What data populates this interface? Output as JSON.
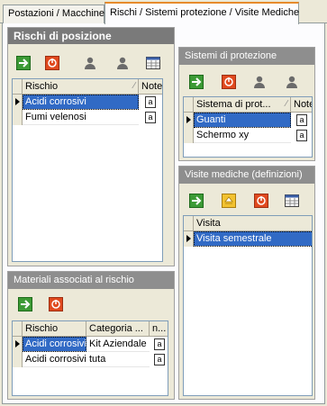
{
  "tabs": [
    {
      "label": "Postazioni / Macchine"
    },
    {
      "label": "Rischi / Sistemi protezione / Visite Mediche"
    }
  ],
  "rischi": {
    "title": "Rischi di posizione",
    "columns": [
      "Rischio",
      "Note"
    ],
    "rows": [
      {
        "rischio": "Acidi corrosivi",
        "selected": true
      },
      {
        "rischio": "Fumi velenosi",
        "selected": false
      }
    ]
  },
  "materiali": {
    "title": "Materiali associati al rischio",
    "columns": [
      "Rischio",
      "Categoria ...",
      "n..."
    ],
    "rows": [
      {
        "rischio": "Acidi corrosivi",
        "categoria": "Kit Aziendale",
        "selected": true
      },
      {
        "rischio": "Acidi corrosivi",
        "categoria": "tuta",
        "selected": false
      }
    ]
  },
  "sistemi": {
    "title": "Sistemi di protezione",
    "columns": [
      "Sistema di prot...",
      "Note"
    ],
    "rows": [
      {
        "sistema": "Guanti",
        "selected": true
      },
      {
        "sistema": "Schermo xy",
        "selected": false
      }
    ]
  },
  "visite": {
    "title": "Visite mediche (definizioni)",
    "columns": [
      "Visita"
    ],
    "rows": [
      {
        "visita": "Visita semestrale",
        "selected": true
      }
    ]
  },
  "colors": {
    "selection": "#316ac5",
    "panel_header": "#8e8e8e",
    "tab_accent": "#e68b2c"
  },
  "icons": [
    "add-icon",
    "delete-icon",
    "user-icon",
    "user-alt-icon",
    "grid-icon",
    "edit-icon"
  ]
}
